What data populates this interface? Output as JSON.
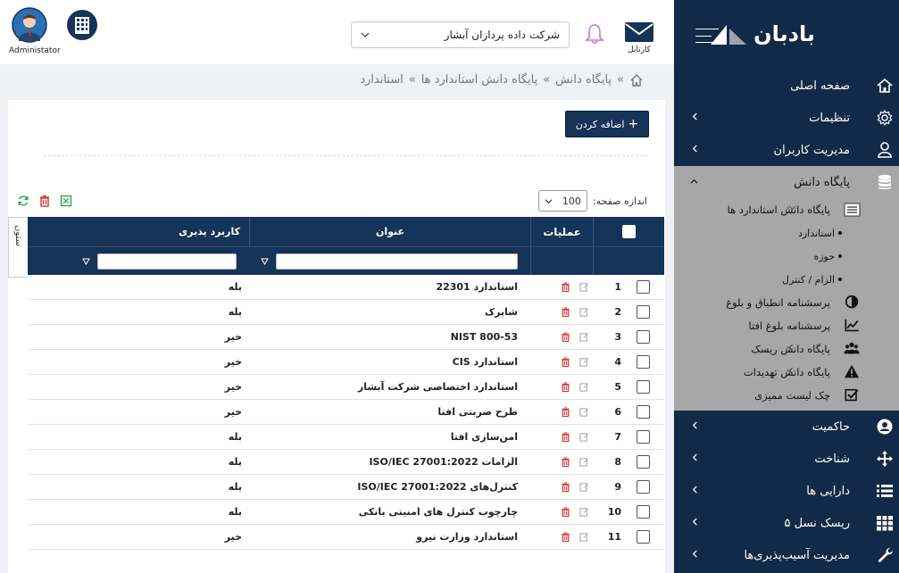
{
  "brand": {
    "name": "بادبان"
  },
  "topbar": {
    "cartable_label": "کارتابل",
    "company_selected": "شرکت داده پردازان آبشار",
    "user_label": "Administator"
  },
  "sidebar": {
    "items_top": [
      {
        "label": "صفحه اصلی",
        "icon": "home-icon",
        "chevron": false
      },
      {
        "label": "تنظیمات",
        "icon": "gear-icon",
        "chevron": true
      },
      {
        "label": "مدیریت کاربران",
        "icon": "user-icon",
        "chevron": true
      }
    ],
    "kb": {
      "label": "پایگاه دانش",
      "icon": "database-icon",
      "standards_kb": "پایگاه دانش استاندارد ها",
      "bullets": [
        "استاندارد",
        "حوزه",
        "الزام / کنترل"
      ],
      "subs": [
        {
          "label": "پرسشنامه انطباق و بلوغ",
          "icon": "half-circle-icon",
          "chevron": false
        },
        {
          "label": "پرسشنامه بلوغ افتا",
          "icon": "line-chart-icon",
          "chevron": false
        },
        {
          "label": "پایگاه دانش ریسک",
          "icon": "users-icon",
          "chevron": true
        },
        {
          "label": "پایگاه دانش تهدیدات",
          "icon": "warning-icon",
          "chevron": true
        },
        {
          "label": "چک لیست ممیزی",
          "icon": "checkbox-icon",
          "chevron": false
        }
      ]
    },
    "items_bottom": [
      {
        "label": "حاکمیت",
        "icon": "account-circle-icon",
        "chevron": true
      },
      {
        "label": "شناخت",
        "icon": "move-icon",
        "chevron": true
      },
      {
        "label": "دارایی ها",
        "icon": "list-icon",
        "chevron": true
      },
      {
        "label": "ریسک نسل ۵",
        "icon": "grid-icon",
        "chevron": true
      },
      {
        "label": "مدیریت آسیب‌پذیری‌ها",
        "icon": "wrench-icon",
        "chevron": true
      }
    ]
  },
  "breadcrumb": {
    "items": [
      "پایگاه دانش",
      "پایگاه دانش استاندارد ها",
      "استاندارد"
    ],
    "sep": "»"
  },
  "toolbar": {
    "add_label": "اضافه کردن",
    "add_plus": "+",
    "page_size_label": "اندازه صفحه:",
    "page_size_value": "100"
  },
  "grid": {
    "columns_tab": "ستون",
    "headers": {
      "ops": "عملیات",
      "title": "عنوان",
      "applicability": "کاربرد پذیری"
    },
    "rows": [
      {
        "num": "1",
        "title": "استاندارد 22301",
        "app": "بله"
      },
      {
        "num": "2",
        "title": "شاپرک",
        "app": "بله"
      },
      {
        "num": "3",
        "title": "NIST 800-53",
        "app": "خیر"
      },
      {
        "num": "4",
        "title": "استاندارد CIS",
        "app": "خیر"
      },
      {
        "num": "5",
        "title": "استاندارد اختصاصی شرکت آبشار",
        "app": "خیر"
      },
      {
        "num": "6",
        "title": "طرح ضربتی افتا",
        "app": "خیر"
      },
      {
        "num": "7",
        "title": "امن‌سازی افتا",
        "app": "بله"
      },
      {
        "num": "8",
        "title": "الزامات ISO/IEC 27001:2022",
        "app": "بله"
      },
      {
        "num": "9",
        "title": "کنترل‌های ISO/IEC 27001:2022",
        "app": "بله"
      },
      {
        "num": "10",
        "title": "چارچوب کنترل های امنیتی بانکی",
        "app": "بله"
      },
      {
        "num": "11",
        "title": "استاندارد وزارت نیرو",
        "app": "خیر"
      }
    ]
  },
  "colors": {
    "sidebar_bg": "#122a47",
    "kb_section_bg": "#a7a7a7",
    "grid_header_bg": "#163358",
    "delete_red": "#d9332b",
    "refresh_green": "#20a04a",
    "bell_purple": "#c27ad6"
  }
}
